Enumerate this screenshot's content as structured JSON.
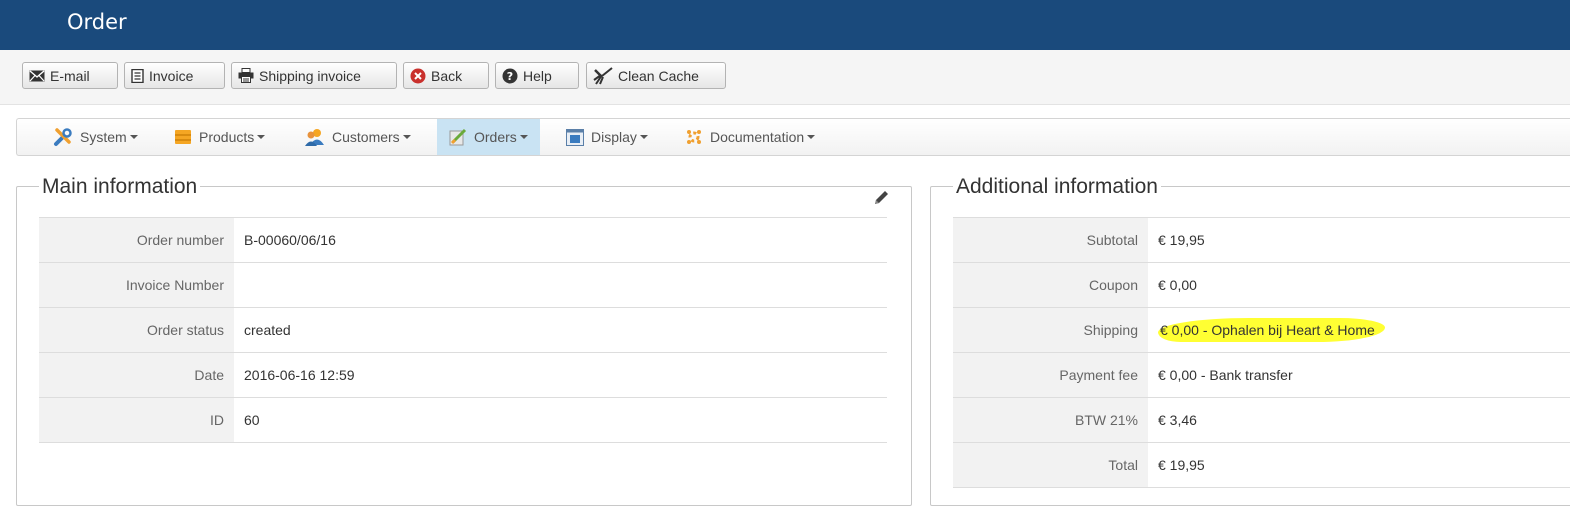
{
  "header": {
    "title": "Order"
  },
  "toolbar": {
    "buttons": [
      {
        "label": "E-mail",
        "icon": "envelope-icon"
      },
      {
        "label": "Invoice",
        "icon": "document-icon"
      },
      {
        "label": "Shipping invoice",
        "icon": "printer-icon"
      },
      {
        "label": "Back",
        "icon": "cancel-circle-icon",
        "icon_color": "#c9302c"
      },
      {
        "label": "Help",
        "icon": "help-circle-icon"
      },
      {
        "label": "Clean Cache",
        "icon": "broom-icon"
      }
    ]
  },
  "menu": {
    "items": [
      {
        "label": "System",
        "icon": "wrench-icon"
      },
      {
        "label": "Products",
        "icon": "box-icon"
      },
      {
        "label": "Customers",
        "icon": "users-icon"
      },
      {
        "label": "Orders",
        "icon": "orders-icon",
        "active": true
      },
      {
        "label": "Display",
        "icon": "display-icon"
      },
      {
        "label": "Documentation",
        "icon": "documentation-icon"
      }
    ],
    "active_color": "#c9e3f3"
  },
  "main_info": {
    "legend": "Main information",
    "rows": [
      {
        "label": "Order number",
        "value": "B-00060/06/16"
      },
      {
        "label": "Invoice Number",
        "value": ""
      },
      {
        "label": "Order status",
        "value": "created"
      },
      {
        "label": "Date",
        "value": "2016-06-16 12:59"
      },
      {
        "label": "ID",
        "value": "60"
      }
    ]
  },
  "additional_info": {
    "legend": "Additional information",
    "rows": [
      {
        "label": "Subtotal",
        "value": "€ 19,95"
      },
      {
        "label": "Coupon",
        "value": "€ 0,00"
      },
      {
        "label": "Shipping",
        "value": "€ 0,00 - Ophalen bij Heart & Home",
        "highlighted": true
      },
      {
        "label": "Payment fee",
        "value": "€ 0,00 - Bank transfer"
      },
      {
        "label": "BTW 21%",
        "value": "€ 3,46"
      },
      {
        "label": "Total",
        "value": "€ 19,95"
      }
    ]
  },
  "colors": {
    "header": "#1a4a7c",
    "highlight": "#ffff33"
  }
}
